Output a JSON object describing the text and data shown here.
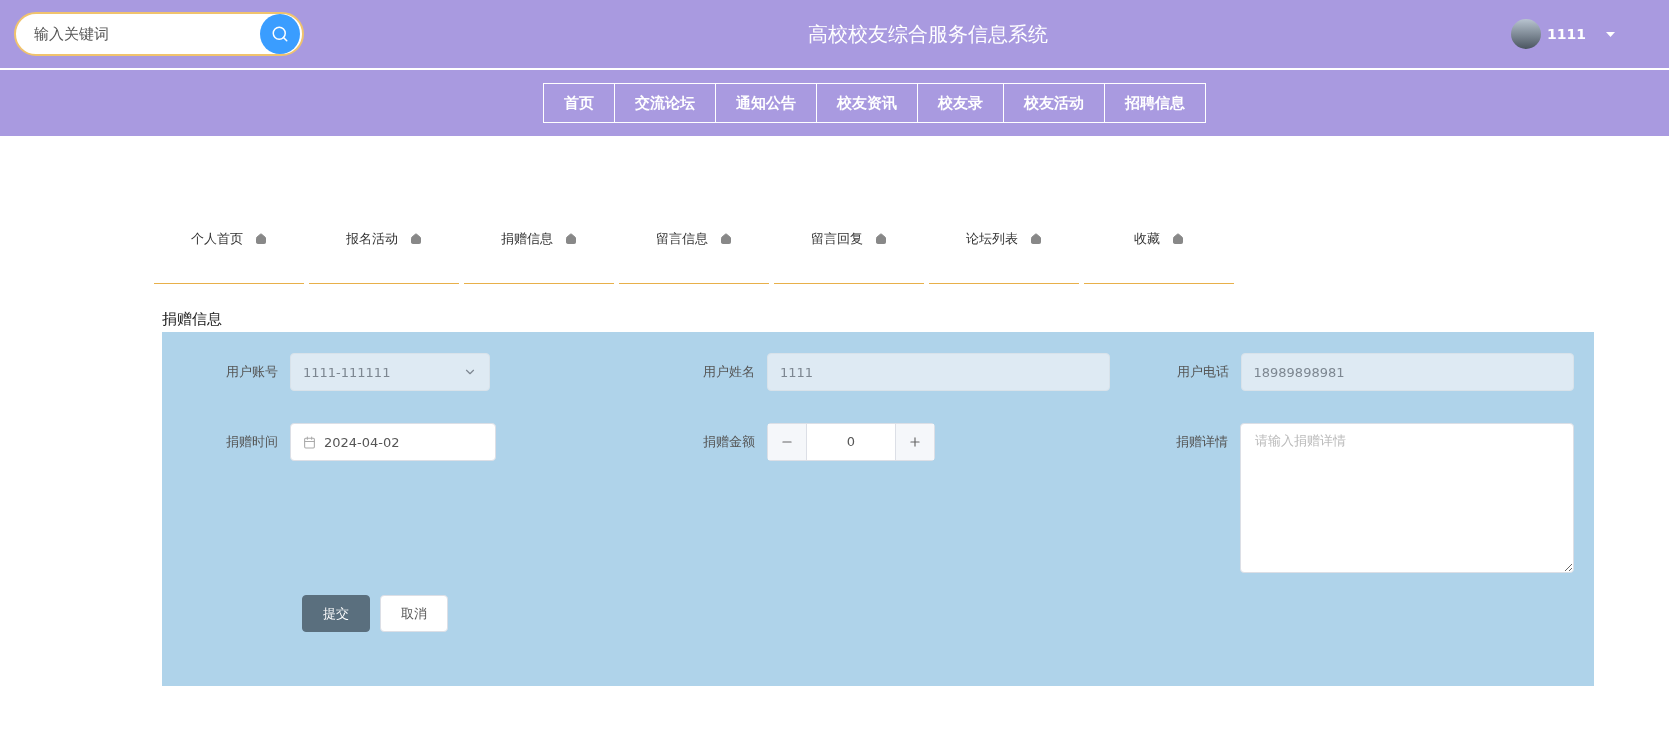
{
  "header": {
    "search": {
      "placeholder": "输入关键词"
    },
    "title": "高校校友综合服务信息系统",
    "user": {
      "name": "1111"
    }
  },
  "nav": [
    {
      "label": "首页"
    },
    {
      "label": "交流论坛"
    },
    {
      "label": "通知公告"
    },
    {
      "label": "校友资讯"
    },
    {
      "label": "校友录"
    },
    {
      "label": "校友活动"
    },
    {
      "label": "招聘信息"
    }
  ],
  "tabs": [
    {
      "label": "个人首页"
    },
    {
      "label": "报名活动"
    },
    {
      "label": "捐赠信息"
    },
    {
      "label": "留言信息"
    },
    {
      "label": "留言回复"
    },
    {
      "label": "论坛列表"
    },
    {
      "label": "收藏"
    }
  ],
  "section_title": "捐赠信息",
  "form": {
    "fields": [
      {
        "kind": "select",
        "label": "用户账号",
        "value": "1111-111111",
        "disabled": true
      },
      {
        "kind": "text",
        "label": "用户姓名",
        "value": "1111",
        "disabled": true
      },
      {
        "kind": "text",
        "label": "用户电话",
        "value": "18989898981",
        "disabled": true
      },
      {
        "kind": "date",
        "label": "捐赠时间",
        "value": "2024-04-02",
        "disabled": false
      },
      {
        "kind": "number",
        "label": "捐赠金额",
        "value": "0",
        "disabled": false
      },
      {
        "kind": "textarea",
        "label": "捐赠详情",
        "placeholder": "请输入捐赠详情",
        "disabled": false
      }
    ],
    "buttons": [
      {
        "kind": "primary",
        "label": "提交"
      },
      {
        "kind": "default",
        "label": "取消"
      }
    ]
  }
}
